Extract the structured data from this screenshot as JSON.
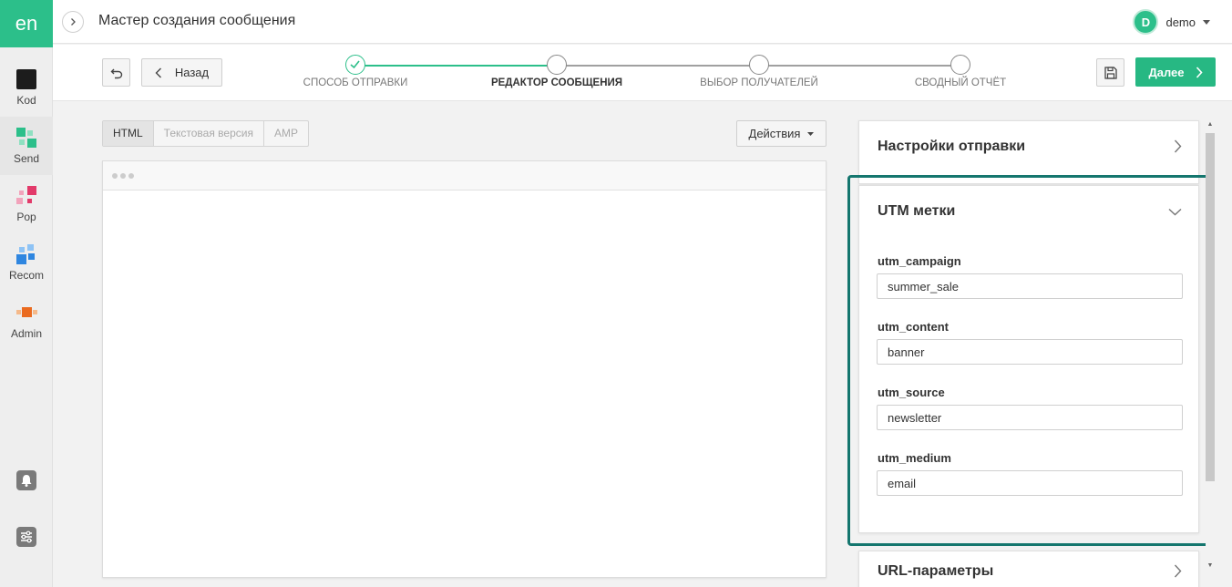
{
  "rail": {
    "logo": "en",
    "items": [
      {
        "label": "Kod",
        "icon": "kod-icon"
      },
      {
        "label": "Send",
        "icon": "send-icon"
      },
      {
        "label": "Pop",
        "icon": "pop-icon"
      },
      {
        "label": "Recom",
        "icon": "recom-icon"
      },
      {
        "label": "Admin",
        "icon": "admin-icon"
      }
    ],
    "bottom_icons": [
      "bell-icon",
      "sliders-icon"
    ]
  },
  "header": {
    "title": "Мастер создания сообщения",
    "user_initial": "D",
    "user_name": "demo"
  },
  "wizard": {
    "back_label": "Назад",
    "next_label": "Далее",
    "steps": [
      {
        "label": "Способ отправки",
        "state": "done"
      },
      {
        "label": "Редактор сообщения",
        "state": "active"
      },
      {
        "label": "Выбор получателей",
        "state": "pending"
      },
      {
        "label": "Сводный отчёт",
        "state": "pending"
      }
    ]
  },
  "editor": {
    "tabs": [
      {
        "label": "HTML",
        "active": true
      },
      {
        "label": "Текстовая версия",
        "active": false
      },
      {
        "label": "AMP",
        "active": false
      }
    ],
    "actions_label": "Действия"
  },
  "settings_panel": {
    "title": "Настройки отправки"
  },
  "utm_panel": {
    "title": "UTM метки",
    "fields": [
      {
        "label": "utm_campaign",
        "value": "summer_sale"
      },
      {
        "label": "utm_content",
        "value": "banner"
      },
      {
        "label": "utm_source",
        "value": "newsletter"
      },
      {
        "label": "utm_medium",
        "value": "email"
      }
    ]
  },
  "url_panel": {
    "title": "URL-параметры"
  },
  "colors": {
    "accent": "#2cbf8a",
    "next_button": "#27b883",
    "highlight_border": "#14766e"
  }
}
